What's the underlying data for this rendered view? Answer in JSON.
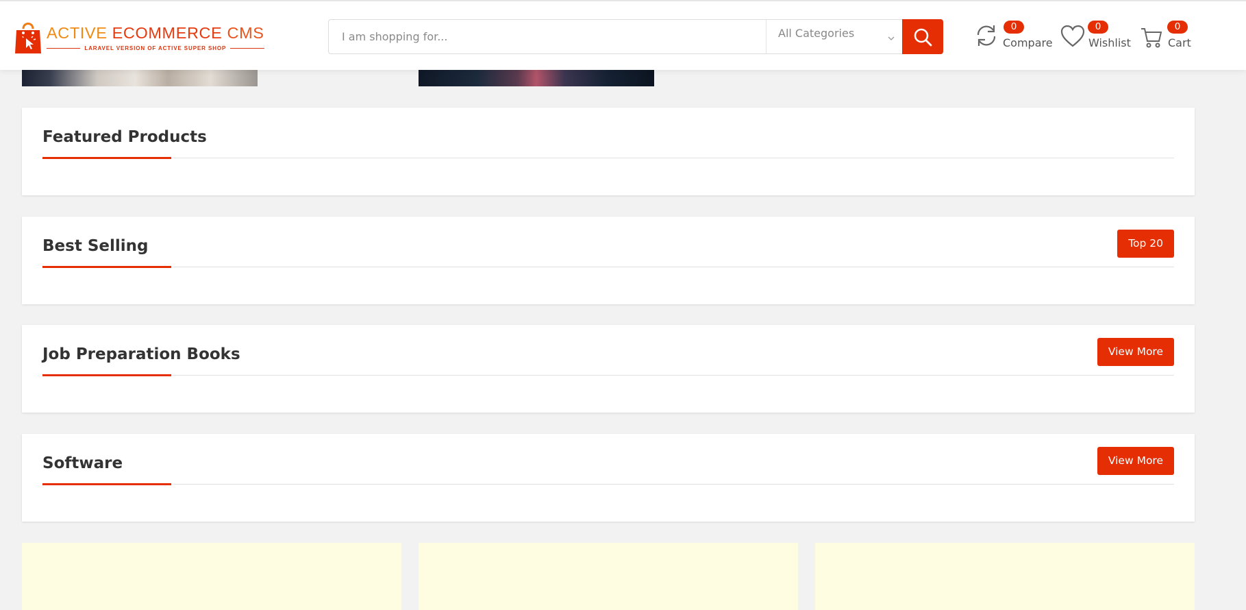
{
  "header": {
    "logo": {
      "title_word1": "ACTIVE",
      "title_word2": "ECOMMERCE",
      "title_word3": "CMS",
      "subtitle": "LARAVEL VERSION OF ACTIVE SUPER SHOP"
    },
    "search": {
      "placeholder": "I am shopping for...",
      "category": "All Categories",
      "icon": "search-icon"
    },
    "compare": {
      "count": "0",
      "label": "Compare",
      "icon": "refresh-icon"
    },
    "wishlist": {
      "count": "0",
      "label": "Wishlist",
      "icon": "heart-icon"
    },
    "cart": {
      "count": "0",
      "label": "Cart",
      "icon": "cart-icon"
    }
  },
  "sections": {
    "featured": {
      "title": "Featured Products"
    },
    "best_selling": {
      "title": "Best Selling",
      "button": "Top 20"
    },
    "job_books": {
      "title": "Job Preparation Books",
      "button": "View More"
    },
    "software": {
      "title": "Software",
      "button": "View More"
    }
  },
  "colors": {
    "accent": "#e62e04",
    "page_background": "#f2f2f2",
    "promo_background": "#fefde2"
  }
}
